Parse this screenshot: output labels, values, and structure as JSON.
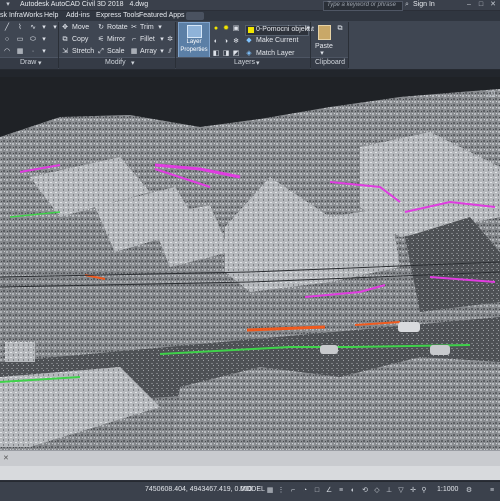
{
  "titlebar": {
    "app_title": "Autodesk AutoCAD Civil 3D 2018",
    "doc_name": "4.dwg",
    "search_placeholder": "Type a keyword or phrase",
    "sign_in": "Sign In"
  },
  "menubar": {
    "items": [
      "sk InfraWorks",
      "Help",
      "Add-ins",
      "Express Tools",
      "Featured Apps"
    ]
  },
  "ribbon": {
    "modify": {
      "move": "Move",
      "rotate": "Rotate",
      "trim": "Trim",
      "copy": "Copy",
      "mirror": "Mirror",
      "fillet": "Fillet",
      "stretch": "Stretch",
      "scale": "Scale",
      "array": "Array"
    },
    "layer_properties": {
      "line1": "Layer",
      "line2": "Properties"
    },
    "layers": {
      "current_layer": "0-Pomocni objekat",
      "make_current": "Make Current",
      "match_layer": "Match Layer"
    },
    "clipboard": {
      "paste": "Paste"
    },
    "panels": {
      "draw": "Draw",
      "modify": "Modify",
      "layers": "Layers",
      "clipboard": "Clipboard"
    }
  },
  "statusbar": {
    "coordinates": "7450608.404, 4943467.419, 0.000",
    "model": "MODEL",
    "scale": "1:1000"
  },
  "colors": {
    "accent_magenta": "#e03ce0",
    "accent_green": "#3fd24a",
    "accent_orange": "#f05a1e",
    "ribbon_bg": "#3f4652",
    "layer_swatch": "#f2e600"
  }
}
